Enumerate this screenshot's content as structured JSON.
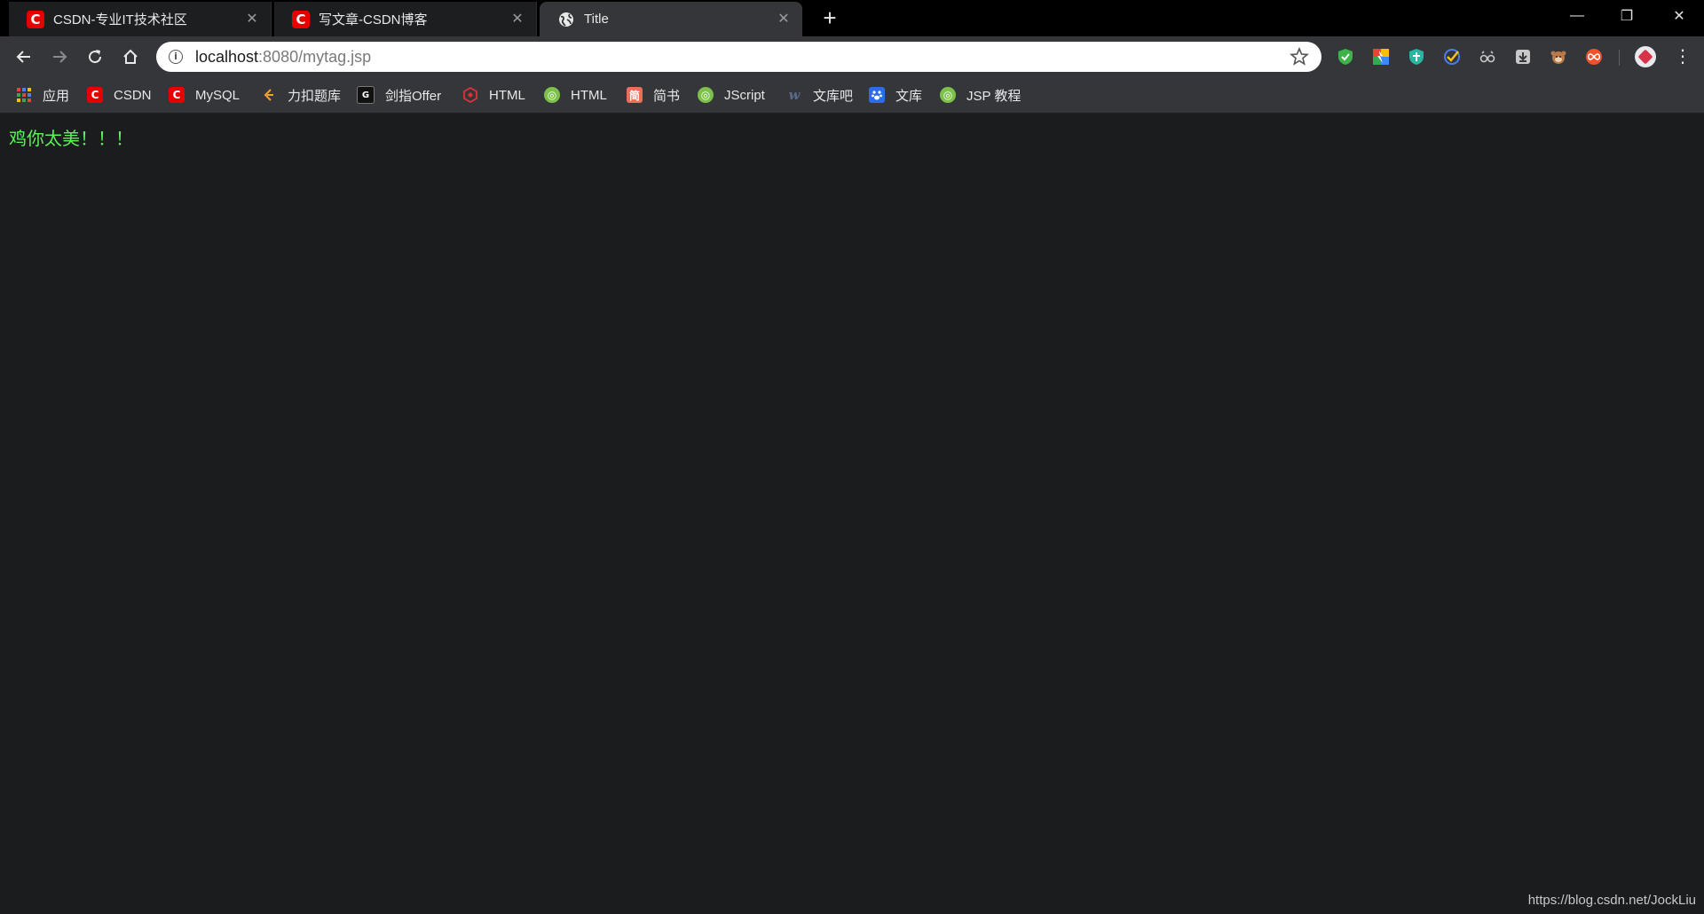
{
  "tabs": [
    {
      "title": "CSDN-专业IT技术社区",
      "icon": "csdn-icon",
      "active": false
    },
    {
      "title": "写文章-CSDN博客",
      "icon": "csdn-icon",
      "active": false
    },
    {
      "title": "Title",
      "icon": "globe-icon",
      "active": true
    }
  ],
  "tab_close_glyph": "✕",
  "new_tab_glyph": "+",
  "window_controls": {
    "minimize": "—",
    "restore": "❐",
    "close": "✕"
  },
  "omnibox": {
    "url_host": "localhost",
    "url_rest": ":8080/mytag.jsp"
  },
  "bookmarks": [
    {
      "label": "应用",
      "icon": "apps-grid-icon"
    },
    {
      "label": "CSDN",
      "icon": "csdn-icon"
    },
    {
      "label": "MySQL",
      "icon": "csdn-icon"
    },
    {
      "label": "力扣题库",
      "icon": "leetcode-icon"
    },
    {
      "label": "剑指Offer",
      "icon": "nowcoder-icon"
    },
    {
      "label": "HTML",
      "icon": "html-icon"
    },
    {
      "label": "HTML",
      "icon": "runoob-icon"
    },
    {
      "label": "简书",
      "icon": "jianshu-icon"
    },
    {
      "label": "JScript",
      "icon": "runoob-icon"
    },
    {
      "label": "文库吧",
      "icon": "wenkuba-icon"
    },
    {
      "label": "文库",
      "icon": "baidu-wenku-icon"
    },
    {
      "label": "JSP 教程",
      "icon": "runoob-icon"
    }
  ],
  "page": {
    "text": "鸡你太美！！！",
    "text_color": "#5ef15a",
    "background": "#1b1c1e"
  },
  "watermark": "https://blog.csdn.net/JockLiu",
  "colors": {
    "tab_strip": "#000000",
    "toolbar": "#35363a",
    "csdn_red": "#e60000"
  }
}
